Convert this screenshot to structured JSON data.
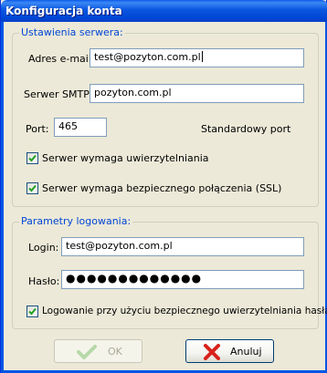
{
  "window": {
    "title": "Konfiguracja konta"
  },
  "server_group": {
    "legend": "Ustawienia serwera:",
    "email_label": "Adres e-mail:",
    "email_value": "test@pozyton.com.pl",
    "smtp_label": "Serwer SMTP:",
    "smtp_value": "pozyton.com.pl",
    "port_label": "Port:",
    "port_value": "465",
    "default_port_label": "Standardowy port",
    "auth_checkbox": {
      "label": "Serwer wymaga uwierzytelniania",
      "checked": true
    },
    "ssl_checkbox": {
      "label": "Serwer wymaga bezpiecznego połączenia (SSL)",
      "checked": true
    }
  },
  "login_group": {
    "legend": "Parametry logowania:",
    "login_label": "Login:",
    "login_value": "test@pozyton.com.pl",
    "password_label": "Hasło:",
    "password_value": "●●●●●●●●●●●●●",
    "secure_auth_checkbox": {
      "label": "Logowanie przy użyciu bezpiecznego uwierzytelniania hasła",
      "checked": true
    }
  },
  "buttons": {
    "ok_label": "OK",
    "ok_enabled": false,
    "cancel_label": "Anuluj"
  },
  "colors": {
    "accent": "#0046d5",
    "check_green": "#21a121",
    "cancel_red": "#d8221a"
  },
  "icons": {
    "ok": "check-icon",
    "cancel": "x-icon"
  }
}
